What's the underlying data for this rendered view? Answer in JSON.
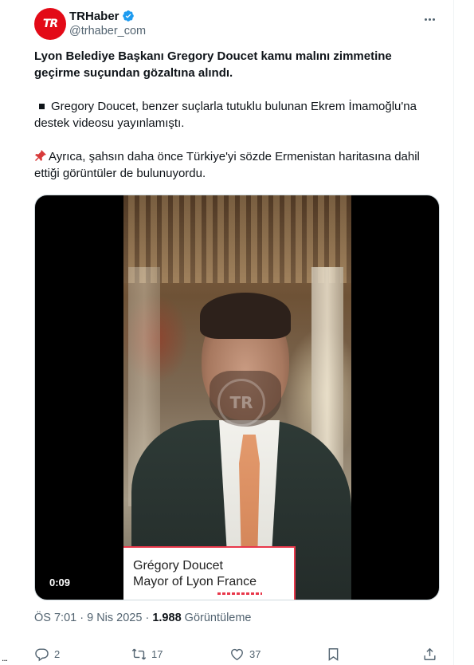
{
  "tweet": {
    "author": {
      "display_name": "TRHaber",
      "handle": "@trhaber_com",
      "verified": true,
      "avatar_text": "TR",
      "avatar_color": "#e30a17"
    },
    "text": {
      "headline": "Lyon Belediye Başkanı Gregory Doucet kamu malını zimmetine geçirme suçundan gözaltına alındı.",
      "paragraph_2": "Gregory Doucet, benzer suçlarla tutuklu bulunan Ekrem İmamoğlu'na destek videosu yayınlamıştı.",
      "paragraph_3": "Ayrıca, şahsın daha önce Türkiye'yi sözde Ermenistan haritasına dahil ettiği görüntüler de bulunuyordu."
    },
    "media": {
      "duration": "0:09",
      "caption_line1": "Grégory Doucet",
      "caption_line2": "Mayor of Lyon France",
      "watermark": "TR"
    },
    "meta": {
      "time": "ÖS 7:01",
      "separator": "·",
      "date": "9 Nis 2025",
      "views_count": "1.988",
      "views_label": "Görüntüleme"
    },
    "actions": {
      "replies": "2",
      "reposts": "17",
      "likes": "37"
    }
  },
  "icons": {
    "verified": "verified-badge-icon",
    "more": "more-dots-icon",
    "bullet": "black-square-icon",
    "pin": "pushpin-icon",
    "reply": "reply-icon",
    "repost": "repost-icon",
    "like": "heart-icon",
    "bookmark": "bookmark-icon",
    "share": "share-icon"
  },
  "colors": {
    "accent": "#1d9bf0",
    "muted": "#536471",
    "text": "#0f1419"
  },
  "sidebar_fragment": "..."
}
